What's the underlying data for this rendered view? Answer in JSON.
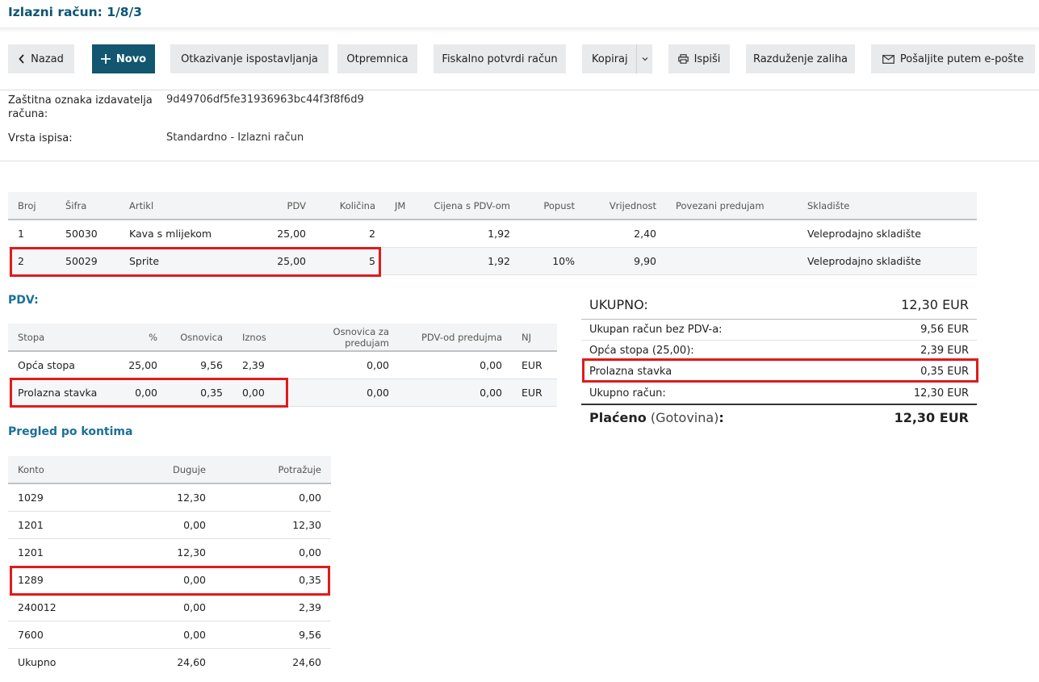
{
  "header": {
    "title": "Izlazni račun: 1/8/3"
  },
  "toolbar": {
    "back": "Nazad",
    "new": "Novo",
    "cancel_issue": "Otkazivanje ispostavljanja",
    "delivery_note": "Otpremnica",
    "fiscal_confirm": "Fiskalno potvrdi račun",
    "copy": "Kopiraj",
    "print": "Ispiši",
    "stock_discharge": "Razduženje zaliha",
    "send_email": "Pošaljite putem e-pošte"
  },
  "info": {
    "zki_label": "Zaštitna oznaka izdavatelja računa:",
    "zki_value": "9d49706df5fe31936963bc44f3f8f6d9",
    "print_type_label": "Vrsta ispisa:",
    "print_type_value": "Standardno - Izlazni račun"
  },
  "items_table": {
    "headers": [
      "Broj",
      "Šifra",
      "Artikl",
      "PDV",
      "Količina",
      "JM",
      "Cijena s PDV-om",
      "Popust",
      "Vrijednost",
      "Povezani predujam",
      "Skladište"
    ],
    "rows": [
      [
        "1",
        "50030",
        "Kava s mlijekom",
        "25,00",
        "2",
        "",
        "1,92",
        "",
        "2,40",
        "",
        "Veleprodajno skladište"
      ],
      [
        "2",
        "50029",
        "Sprite",
        "25,00",
        "5",
        "",
        "1,92",
        "10%",
        "9,90",
        "",
        "Veleprodajno skladište"
      ]
    ]
  },
  "vat": {
    "title": "PDV:",
    "headers": [
      "Stopa",
      "%",
      "Osnovica",
      "Iznos",
      "Osnovica za predujam",
      "PDV-od predujma",
      "NJ"
    ],
    "rows": [
      [
        "Opća stopa",
        "25,00",
        "9,56",
        "2,39",
        "0,00",
        "0,00",
        "EUR"
      ],
      [
        "Prolazna stavka",
        "0,00",
        "0,35",
        "0,00",
        "0,00",
        "0,00",
        "EUR"
      ]
    ]
  },
  "accounts": {
    "title": "Pregled po kontima",
    "headers": [
      "Konto",
      "Duguje",
      "Potražuje"
    ],
    "rows": [
      [
        "1029",
        "12,30",
        "0,00"
      ],
      [
        "1201",
        "0,00",
        "12,30"
      ],
      [
        "1201",
        "12,30",
        "0,00"
      ],
      [
        "1289",
        "0,00",
        "0,35"
      ],
      [
        "240012",
        "0,00",
        "2,39"
      ],
      [
        "7600",
        "0,00",
        "9,56"
      ]
    ],
    "total": [
      "Ukupno",
      "24,60",
      "24,60"
    ]
  },
  "summary": {
    "total_label": "UKUPNO:",
    "total_value": "12,30 EUR",
    "rows": [
      [
        "Ukupan račun bez PDV-a:",
        "9,56 EUR"
      ],
      [
        "Opća stopa (25,00):",
        "2,39 EUR"
      ],
      [
        "Prolazna stavka",
        "0,35 EUR"
      ],
      [
        "Ukupno račun:",
        "12,30 EUR"
      ]
    ],
    "paid_label": "Plaćeno",
    "paid_method": "(Gotovina)",
    "paid_colon": ":",
    "paid_value": "12,30 EUR"
  },
  "colors": {
    "primary": "#12566f",
    "title": "#0d5574",
    "section": "#1a7099",
    "highlight": "#e01b1b"
  }
}
